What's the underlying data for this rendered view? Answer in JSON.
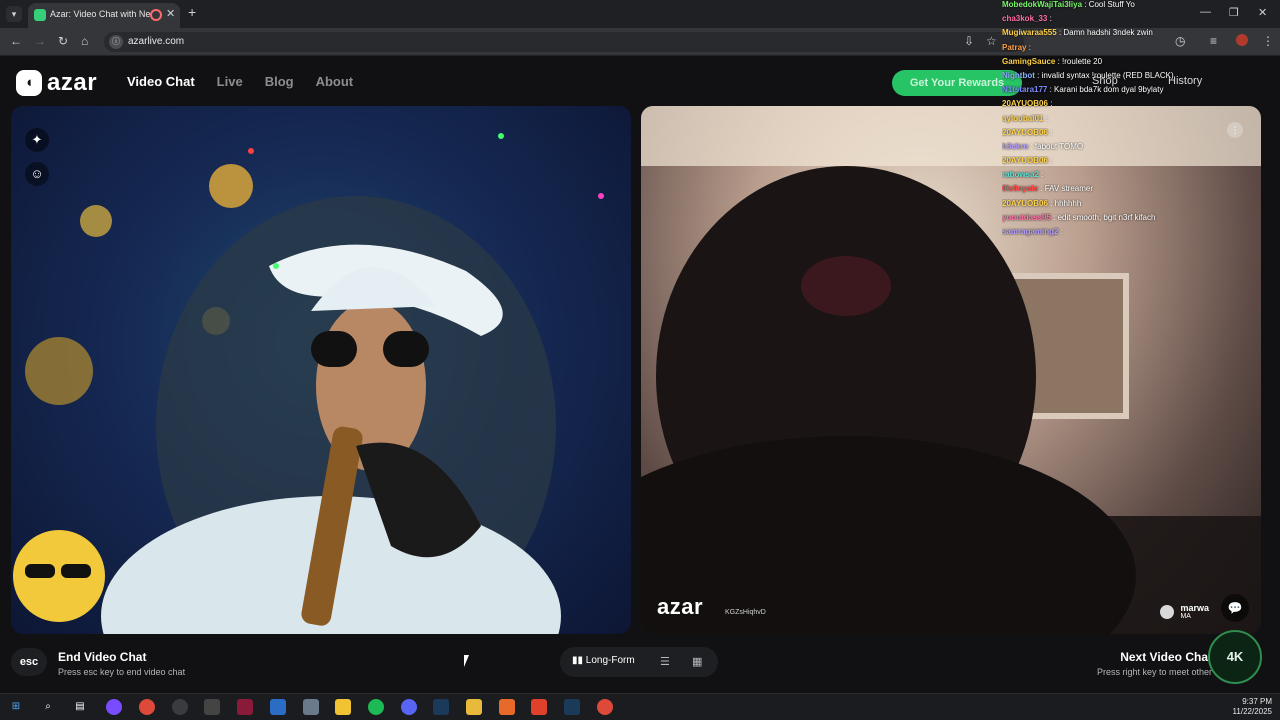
{
  "browser": {
    "tab_title": "Azar: Video Chat with New",
    "url": "azarlive.com",
    "window_controls": [
      "—",
      "❐",
      "✕"
    ]
  },
  "site": {
    "logo_text": "azar",
    "nav": [
      "Video Chat",
      "Live",
      "Blog",
      "About"
    ],
    "rewards_label": "Get Your Rewards",
    "shop_label": "Shop",
    "history_label": "History"
  },
  "video": {
    "watermark": "azar",
    "watermark_code": "KGZsHiqhvD",
    "peer_name": "marwa",
    "peer_country": "MA"
  },
  "controls": {
    "esc_key": "esc",
    "end_title": "End Video Chat",
    "end_sub": "Press esc key to end video chat",
    "layout_long": "Long-Form",
    "next_title": "Next Video Chat",
    "next_sub": "Press right key to meet other",
    "badge": "4K"
  },
  "chat": [
    {
      "user": "MobedokWajiTai3liya",
      "msg": ": Cool Stuff Yo",
      "color": "#7bf56b"
    },
    {
      "user": "cha3kok_33",
      "msg": ":",
      "color": "#ff6fa8"
    },
    {
      "user": "Mugiwaraa555",
      "msg": ": Damn hadshi 3ndek zwin",
      "color": "#ffd24a"
    },
    {
      "user": "Patray",
      "msg": ":",
      "color": "#ffa24a"
    },
    {
      "user": "GamingSauce",
      "msg": ": !roulette 20",
      "color": "#ffd24a"
    },
    {
      "user": "Nightbot",
      "msg": ": invalid syntax !roulette (RED BLACK)",
      "color": "#8ab4ff"
    },
    {
      "user": "N1tstara177",
      "msg": ": Karani bda7k dom dyal 9bylaty",
      "color": "#7c8cff"
    },
    {
      "user": "20AYUOB06",
      "msg": ":",
      "color": "#ffd24a"
    },
    {
      "user": "ayloubal01",
      "msg": ":",
      "color": "#ffd24a"
    },
    {
      "user": "20AYUOB06",
      "msg": ":",
      "color": "#ffd24a"
    },
    {
      "user": "h3ckrn",
      "msg": ": fabout TOMO",
      "color": "#b49cff"
    },
    {
      "user": "20AYUOB06",
      "msg": ":",
      "color": "#ffd24a"
    },
    {
      "user": "rabowsa2",
      "msg": ":",
      "color": "#5ae0d3"
    },
    {
      "user": "0ls0nyale",
      "msg": ": FAV streamer",
      "color": "#ff4a4a"
    },
    {
      "user": "20AYUOB06",
      "msg": ": hhhhhh",
      "color": "#ffd24a"
    },
    {
      "user": "yuoutdass95",
      "msg": ": edit smooth, bgit n3rf kifach",
      "color": "#ff6fa8"
    },
    {
      "user": "samragaming2",
      "msg": ":",
      "color": "#b49cff"
    }
  ],
  "taskbar": {
    "time": "9:37 PM",
    "date": "11/22/2025"
  }
}
